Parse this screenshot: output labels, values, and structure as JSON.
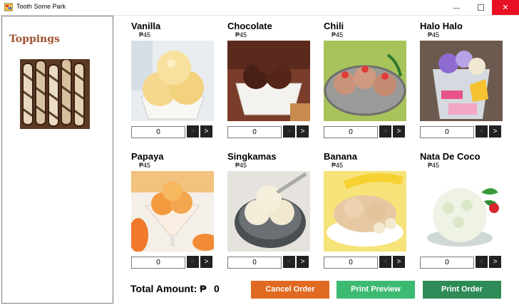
{
  "window": {
    "title": "Tooth Some Park",
    "minimize_glyph": "—",
    "maximize_glyph": "☐",
    "close_glyph": "✕"
  },
  "sidebar": {
    "title": "Toppings"
  },
  "products": [
    {
      "name": "Vanilla",
      "price": "₱45",
      "qty": "0",
      "prev": "<",
      "next": ">"
    },
    {
      "name": "Chocolate",
      "price": "₱45",
      "qty": "0",
      "prev": "<",
      "next": ">"
    },
    {
      "name": "Chili",
      "price": "₱45",
      "qty": "0",
      "prev": "<",
      "next": ">"
    },
    {
      "name": "Halo Halo",
      "price": "₱45",
      "qty": "0",
      "prev": "<",
      "next": ">"
    },
    {
      "name": "Papaya",
      "price": "₱45",
      "qty": "0",
      "prev": "<",
      "next": ">"
    },
    {
      "name": "Singkamas",
      "price": "₱45",
      "qty": "0",
      "prev": "<",
      "next": ">"
    },
    {
      "name": "Banana",
      "price": "₱45",
      "qty": "0",
      "prev": "<",
      "next": ">"
    },
    {
      "name": "Nata De Coco",
      "price": "₱45",
      "qty": "0",
      "prev": "<",
      "next": ">"
    }
  ],
  "footer": {
    "total_label": "Total Amount: ₱",
    "total_value": "0",
    "cancel_label": "Cancel Order",
    "preview_label": "Print Preview",
    "print_label": "Print Order"
  },
  "colors": {
    "cancel": "#e06a22",
    "preview": "#3dba72",
    "print": "#2e8b57",
    "close": "#e81123",
    "toppings_title": "#a0522d"
  }
}
